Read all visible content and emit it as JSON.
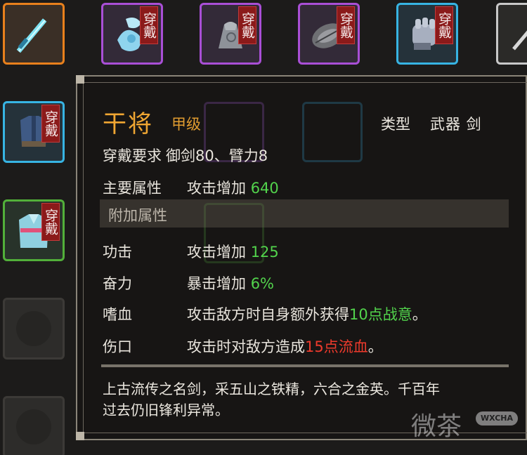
{
  "inventory": {
    "worn_tag": "穿戴",
    "slots": [
      {
        "rarity": "orange",
        "icon": "sword-icon",
        "worn": false
      },
      {
        "rarity": "purple",
        "icon": "jade-ornament-icon",
        "worn": true
      },
      {
        "rarity": "purple",
        "icon": "iron-bell-icon",
        "worn": true
      },
      {
        "rarity": "purple",
        "icon": "stone-disc-icon",
        "worn": true
      },
      {
        "rarity": "blue",
        "icon": "gauntlet-icon",
        "worn": true
      },
      {
        "rarity": "gray",
        "icon": "blade-icon",
        "worn": false
      },
      {
        "rarity": "blue",
        "icon": "armor-vest-icon",
        "worn": true
      },
      {
        "rarity": "green",
        "icon": "robe-icon",
        "worn": true
      }
    ]
  },
  "tooltip": {
    "name": "干将",
    "grade": "甲级",
    "type_label": "类型",
    "type_value": "武器 剑",
    "requirement_label": "穿戴要求",
    "requirement_value": "御剑80、臂力8",
    "main_attr_label": "主要属性",
    "main_attr_text": "攻击增加",
    "main_attr_value": "640",
    "extra_title": "附加属性",
    "extras": [
      {
        "label": "功击",
        "text": "攻击增加",
        "value": "125"
      },
      {
        "label": "奋力",
        "text": "暴击增加",
        "value": "6%"
      }
    ],
    "traits": [
      {
        "label": "嗜血",
        "text": "攻击敌方时自身额外获得",
        "highlight": "10点战意",
        "tail": "。",
        "color": "#52d34c"
      },
      {
        "label": "伤口",
        "text": "攻击时对敌方造成",
        "highlight": "15点流血",
        "tail": "。",
        "color": "#ee3a2c"
      }
    ],
    "description_line1": "上古流传之名剑，采五山之铁精，六合之金英。千百年",
    "description_line2": "过去仍旧锋利异常。"
  },
  "watermark": {
    "text": "微茶",
    "badge": "WXCHA"
  }
}
